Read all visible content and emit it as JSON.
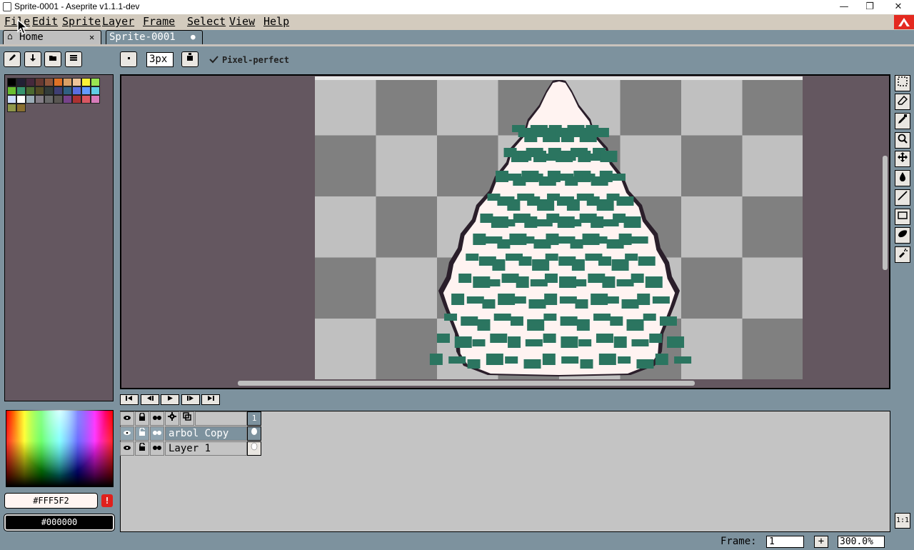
{
  "window": {
    "title": "Sprite-0001 - Aseprite v1.1.1-dev",
    "minimize": "—",
    "restore": "❐",
    "close": "✕"
  },
  "menu": [
    "File",
    "Edit",
    "Sprite",
    "Layer",
    "Frame",
    "Select",
    "View",
    "Help"
  ],
  "tabs": [
    {
      "label": "Home",
      "icon": "home-icon",
      "close": "✕"
    },
    {
      "label": "Sprite-0001",
      "modified_dot": "●"
    }
  ],
  "toolbar": {
    "brush_size": "3px",
    "pixel_perfect_label": "Pixel-perfect",
    "pixel_perfect_checked": true
  },
  "palette": {
    "swatches": [
      "#000000",
      "#222034",
      "#45283c",
      "#663931",
      "#8f563b",
      "#df7126",
      "#d9a066",
      "#eec39a",
      "#fbf236",
      "#99e550",
      "#6abe30",
      "#37946e",
      "#4b692f",
      "#524b24",
      "#323c39",
      "#3f3f74",
      "#306082",
      "#5b6ee1",
      "#639bff",
      "#5fcde4",
      "#cbdbfc",
      "#ffffff",
      "#9badb7",
      "#847e87",
      "#696a6a",
      "#595652",
      "#76428a",
      "#ac3232",
      "#d95763",
      "#d77bba",
      "#8f974a",
      "#8a6f30"
    ]
  },
  "colors": {
    "foreground": "#FFF5F2",
    "background": "#000000",
    "warning": "!"
  },
  "timeline": {
    "header_frame": "1",
    "layers": [
      {
        "name": "arbol Copy"
      },
      {
        "name": "Layer 1"
      }
    ]
  },
  "status": {
    "frame_label": "Frame:",
    "frame_value": "1",
    "add_frame": "+",
    "zoom": "300.0%",
    "actual_size": "1:1"
  }
}
